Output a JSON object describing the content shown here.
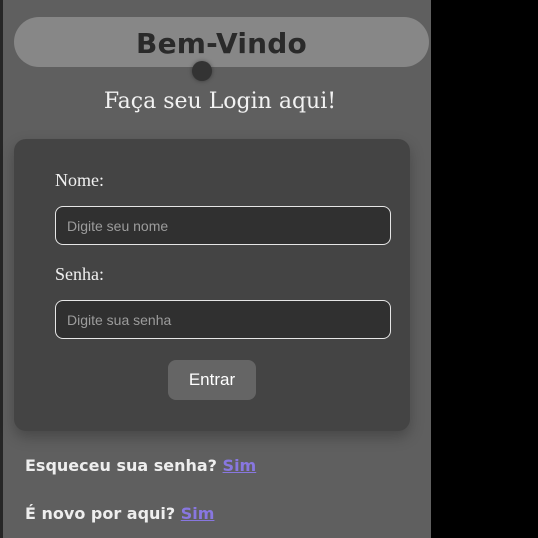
{
  "header": {
    "title": "Bem-Vindo",
    "subtitle": "Faça seu Login aqui!"
  },
  "form": {
    "name_label": "Nome:",
    "name_placeholder": "Digite seu nome",
    "password_label": "Senha:",
    "password_placeholder": "Digite sua senha",
    "submit_label": "Entrar"
  },
  "footer": {
    "forgot_text": "Esqueceu sua senha?",
    "forgot_link": "Sim",
    "new_text": "É novo por aqui?",
    "new_link": "Sim"
  },
  "colors": {
    "page_background": "#5f5f5f",
    "card_background": "#444444",
    "link": "#8877e0"
  }
}
